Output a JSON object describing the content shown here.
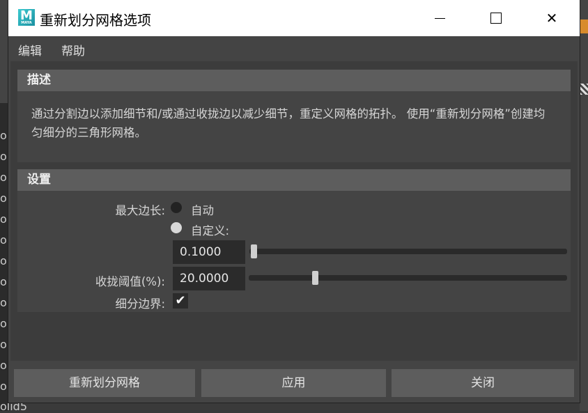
{
  "window": {
    "title": "重新划分网格选项",
    "icon_text": "M",
    "icon_sub": "MAYA"
  },
  "window_controls": {
    "minimize": "minimize-icon",
    "maximize": "maximize-icon",
    "close": "close-icon",
    "close_glyph": "✕"
  },
  "menu": {
    "edit": "编辑",
    "help": "帮助"
  },
  "description": {
    "header": "描述",
    "text": "通过分割边以添加细节和/或通过收拢边以减少细节，重定义网格的拓扑。 使用“重新划分网格”创建均匀细分的三角形网格。"
  },
  "settings": {
    "header": "设置",
    "max_edge_label": "最大边长:",
    "radio_auto": "自动",
    "radio_custom": "自定义:",
    "selected_radio": "auto",
    "max_edge_value": "0.1000",
    "max_edge_slider_fraction": 0.0,
    "collapse_label": "收拢阈值(%):",
    "collapse_value": "20.0000",
    "collapse_slider_fraction": 0.2,
    "border_label": "细分边界:",
    "border_checked": true,
    "check_glyph": "✔"
  },
  "buttons": {
    "remesh": "重新划分网格",
    "apply": "应用",
    "close": "关闭"
  },
  "background": {
    "left_letters": [
      "o",
      "o",
      "o",
      "o",
      "o",
      "o",
      "o",
      "o",
      "o",
      "o",
      "o",
      "o",
      "o"
    ],
    "bottom_text": "olid5"
  }
}
